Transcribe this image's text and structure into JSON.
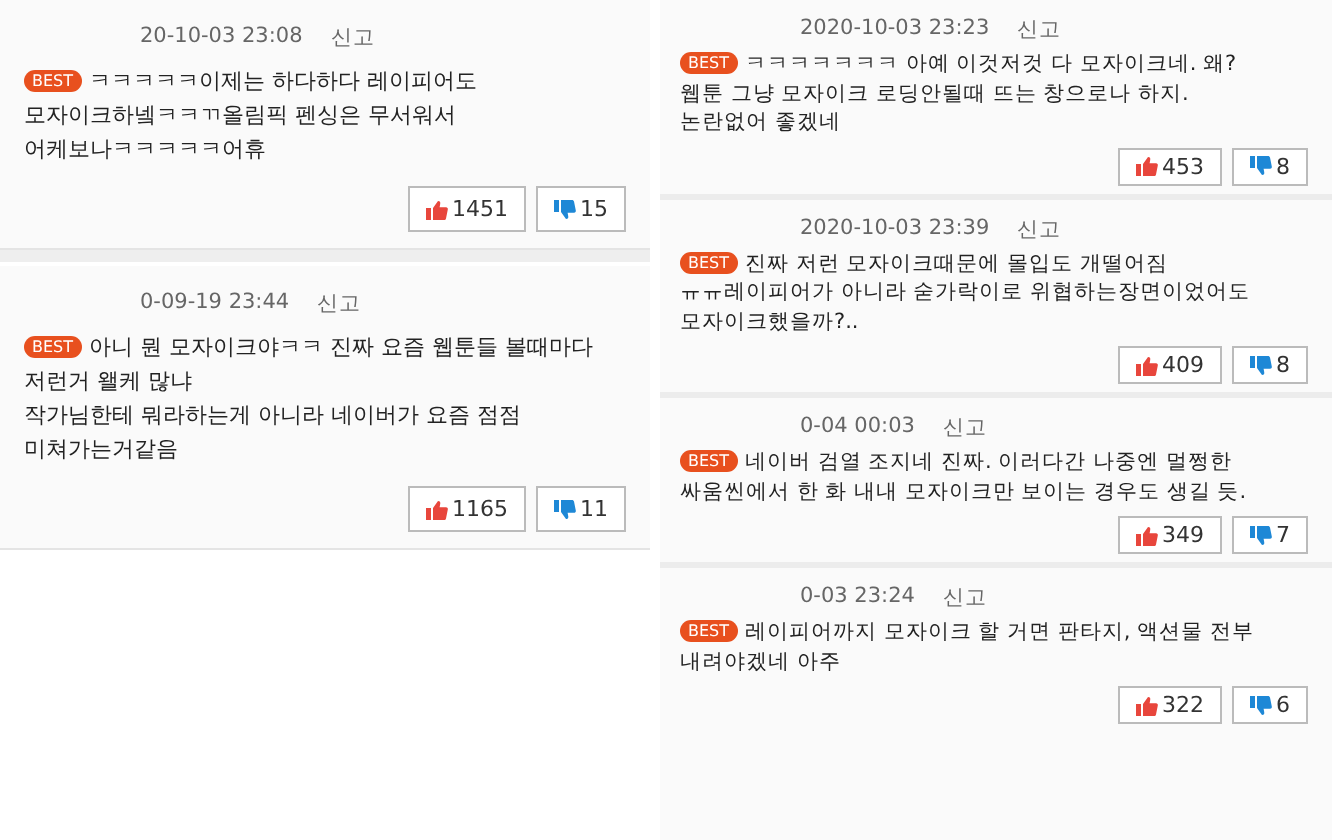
{
  "columns": [
    {
      "comments": [
        {
          "date": "20-10-03 23:08",
          "report": "신고",
          "badge": "BEST",
          "text": "ㅋㅋㅋㅋㅋ이제는 하다하다 레이피어도\n모자이크하넼ㅋㅋㄲ올림픽 펜싱은 무서워서\n어케보나ㅋㅋㅋㅋㅋ어휴",
          "likes": "1451",
          "dislikes": "15"
        },
        {
          "date": "0-09-19 23:44",
          "report": "신고",
          "badge": "BEST",
          "text": "아니 뭔 모자이크야ㅋㅋ 진짜 요즘 웹툰들 볼때마다\n저런거 왤케 많냐\n작가님한테 뭐라하는게 아니라 네이버가 요즘 점점\n미쳐가는거같음",
          "likes": "1165",
          "dislikes": "11"
        }
      ]
    },
    {
      "comments": [
        {
          "date": "2020-10-03 23:23",
          "report": "신고",
          "badge": "BEST",
          "text": "ㅋㅋㅋㅋㅋㅋㅋ 아예 이것저것 다 모자이크네. 왜?\n웹툰 그냥 모자이크 로딩안될때 뜨는 창으로나 하지.\n논란없어 좋겠네",
          "likes": "453",
          "dislikes": "8"
        },
        {
          "date": "2020-10-03 23:39",
          "report": "신고",
          "badge": "BEST",
          "text": "진짜 저런 모자이크때문에 몰입도 개떨어짐\nㅠㅠ레이피어가 아니라 숟가락이로 위협하는장면이었어도\n모자이크했을까?..",
          "likes": "409",
          "dislikes": "8"
        },
        {
          "date": "0-04 00:03",
          "report": "신고",
          "badge": "BEST",
          "text": "네이버 검열 조지네 진짜. 이러다간 나중엔 멀쩡한\n싸움씬에서 한 화 내내 모자이크만 보이는 경우도 생길 듯.",
          "likes": "349",
          "dislikes": "7"
        },
        {
          "date": "0-03 23:24",
          "report": "신고",
          "badge": "BEST",
          "text": "레이피어까지 모자이크 할 거면 판타지, 액션물 전부\n내려야겠네 아주",
          "likes": "322",
          "dislikes": "6"
        }
      ]
    }
  ]
}
